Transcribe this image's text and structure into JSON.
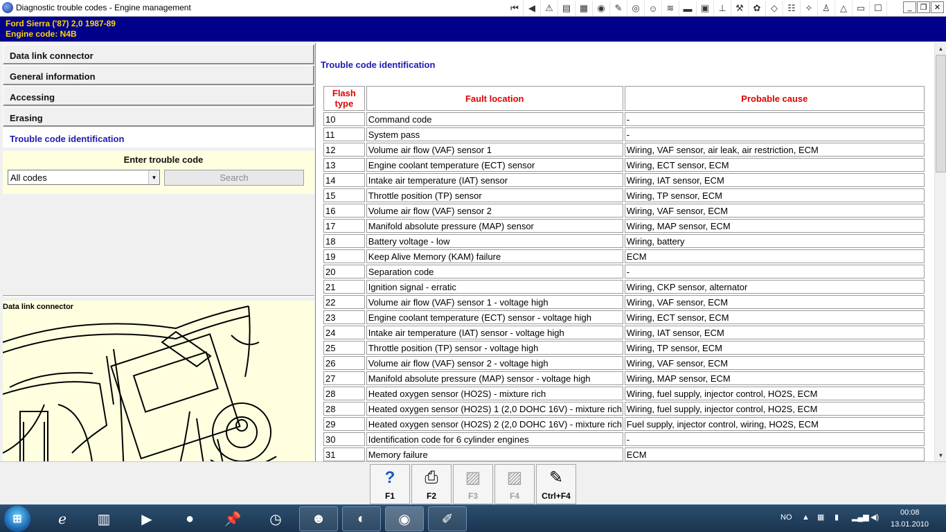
{
  "window": {
    "title": "Diagnostic trouble codes - Engine management"
  },
  "vehicle": {
    "line1": "Ford   Sierra ('87) 2,0  1987-89",
    "line2": "Engine code: N4B"
  },
  "nav": [
    {
      "label": "Data link connector"
    },
    {
      "label": "General information"
    },
    {
      "label": "Accessing"
    },
    {
      "label": "Erasing"
    },
    {
      "label": "Trouble code identification",
      "active": true
    }
  ],
  "code_entry": {
    "label": "Enter trouble code",
    "selected": "All codes",
    "search_label": "Search"
  },
  "dlc": {
    "caption": "Data link connector"
  },
  "content": {
    "title": "Trouble code identification",
    "headers": {
      "flash": "Flash type",
      "fault": "Fault location",
      "cause": "Probable cause"
    },
    "rows": [
      [
        "10",
        "Command code",
        "-"
      ],
      [
        "11",
        "System pass",
        "-"
      ],
      [
        "12",
        "Volume air flow (VAF) sensor 1",
        "Wiring, VAF sensor, air leak, air restriction, ECM"
      ],
      [
        "13",
        "Engine coolant temperature (ECT) sensor",
        "Wiring, ECT sensor, ECM"
      ],
      [
        "14",
        "Intake air temperature (IAT) sensor",
        "Wiring, IAT sensor, ECM"
      ],
      [
        "15",
        "Throttle position (TP) sensor",
        "Wiring, TP sensor, ECM"
      ],
      [
        "16",
        "Volume air flow (VAF) sensor 2",
        "Wiring, VAF sensor, ECM"
      ],
      [
        "17",
        "Manifold absolute pressure (MAP) sensor",
        "Wiring, MAP sensor, ECM"
      ],
      [
        "18",
        "Battery voltage - low",
        "Wiring, battery"
      ],
      [
        "19",
        "Keep Alive Memory (KAM) failure",
        "ECM"
      ],
      [
        "20",
        "Separation code",
        "-"
      ],
      [
        "21",
        "Ignition signal - erratic",
        "Wiring, CKP sensor, alternator"
      ],
      [
        "22",
        "Volume air flow (VAF) sensor 1 - voltage high",
        "Wiring, VAF sensor, ECM"
      ],
      [
        "23",
        "Engine coolant temperature (ECT) sensor - voltage high",
        "Wiring, ECT sensor, ECM"
      ],
      [
        "24",
        "Intake air temperature (IAT) sensor - voltage high",
        "Wiring, IAT sensor, ECM"
      ],
      [
        "25",
        "Throttle position (TP) sensor - voltage high",
        "Wiring, TP sensor, ECM"
      ],
      [
        "26",
        "Volume air flow (VAF) sensor 2 - voltage high",
        "Wiring, VAF sensor, ECM"
      ],
      [
        "27",
        "Manifold absolute pressure (MAP) sensor - voltage high",
        "Wiring, MAP sensor, ECM"
      ],
      [
        "28",
        "Heated oxygen sensor (HO2S) - mixture rich",
        "Wiring, fuel supply, injector control, HO2S, ECM"
      ],
      [
        "28",
        "Heated oxygen sensor (HO2S) 1 (2,0 DOHC 16V) - mixture rich",
        "Wiring, fuel supply, injector control, HO2S, ECM"
      ],
      [
        "29",
        "Heated oxygen sensor (HO2S) 2 (2,0 DOHC 16V) - mixture rich",
        "Fuel supply, injector control, wiring, HO2S, ECM"
      ],
      [
        "30",
        "Identification code for 6 cylinder engines",
        "-"
      ],
      [
        "31",
        "Memory failure",
        "ECM"
      ]
    ]
  },
  "fkeys": [
    {
      "label": "F1",
      "icon": "help-icon",
      "enabled": true
    },
    {
      "label": "F2",
      "icon": "printer-icon",
      "enabled": true
    },
    {
      "label": "F3",
      "icon": "image-icon",
      "enabled": false
    },
    {
      "label": "F4",
      "icon": "image-icon",
      "enabled": false
    },
    {
      "label": "Ctrl+F4",
      "icon": "notepad-icon",
      "enabled": true
    }
  ],
  "tray": {
    "lang": "NO",
    "time": "00:08",
    "date": "13.01.2010"
  }
}
